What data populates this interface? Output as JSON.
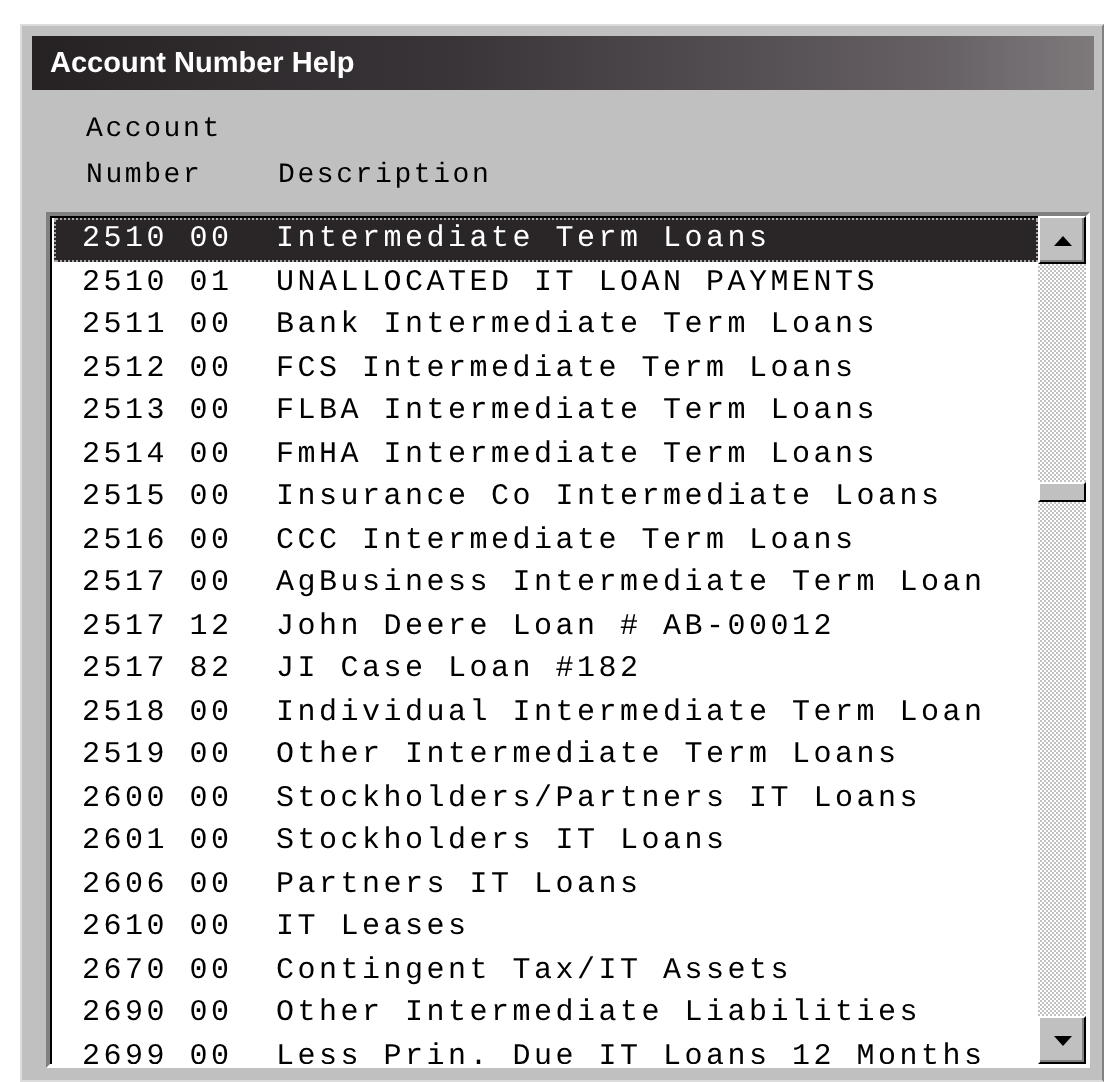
{
  "window": {
    "title": "Account Number Help"
  },
  "columns": [
    {
      "label": "Account Number"
    },
    {
      "label": "Description"
    }
  ],
  "rows": [
    {
      "account": "2510 00",
      "description": "Intermediate Term Loans",
      "selected": true
    },
    {
      "account": "2510 01",
      "description": "UNALLOCATED IT LOAN PAYMENTS",
      "selected": false
    },
    {
      "account": "2511 00",
      "description": "Bank Intermediate Term Loans",
      "selected": false
    },
    {
      "account": "2512 00",
      "description": "FCS Intermediate Term Loans",
      "selected": false
    },
    {
      "account": "2513 00",
      "description": "FLBA Intermediate Term Loans",
      "selected": false
    },
    {
      "account": "2514 00",
      "description": "FmHA Intermediate Term Loans",
      "selected": false
    },
    {
      "account": "2515 00",
      "description": "Insurance Co Intermediate Loans",
      "selected": false
    },
    {
      "account": "2516 00",
      "description": "CCC Intermediate Term Loans",
      "selected": false
    },
    {
      "account": "2517 00",
      "description": "AgBusiness Intermediate Term Loan",
      "selected": false
    },
    {
      "account": "2517 12",
      "description": "John Deere Loan # AB-00012",
      "selected": false
    },
    {
      "account": "2517 82",
      "description": "JI Case Loan #182",
      "selected": false
    },
    {
      "account": "2518 00",
      "description": "Individual Intermediate Term Loan",
      "selected": false
    },
    {
      "account": "2519 00",
      "description": "Other Intermediate Term Loans",
      "selected": false
    },
    {
      "account": "2600 00",
      "description": "Stockholders/Partners IT Loans",
      "selected": false
    },
    {
      "account": "2601 00",
      "description": "Stockholders IT Loans",
      "selected": false
    },
    {
      "account": "2606 00",
      "description": "Partners IT Loans",
      "selected": false
    },
    {
      "account": "2610 00",
      "description": "IT Leases",
      "selected": false
    },
    {
      "account": "2670 00",
      "description": "Contingent Tax/IT Assets",
      "selected": false
    },
    {
      "account": "2690 00",
      "description": "Other Intermediate Liabilities",
      "selected": false
    },
    {
      "account": "2699 00",
      "description": "Less Prin. Due IT Loans 12 Months",
      "selected": false
    }
  ]
}
